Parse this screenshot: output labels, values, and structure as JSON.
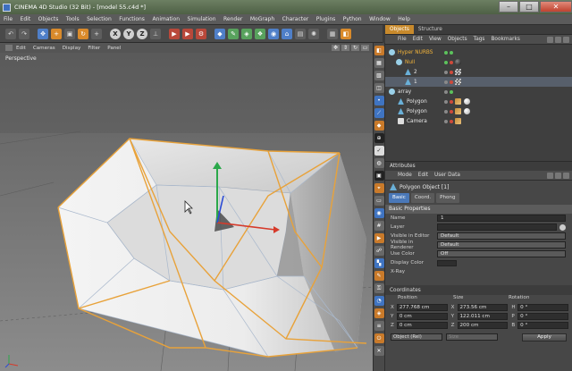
{
  "window": {
    "title": "CINEMA 4D Studio (32 Bit) - [model 55.c4d *]"
  },
  "menubar": [
    "File",
    "Edit",
    "Objects",
    "Tools",
    "Selection",
    "Functions",
    "Animation",
    "Simulation",
    "Render",
    "MoGraph",
    "Character",
    "Plugins",
    "Python",
    "Window",
    "Help"
  ],
  "toolbar": {
    "icons": [
      {
        "name": "undo-icon",
        "glyph": "↶",
        "cls": ""
      },
      {
        "name": "redo-icon",
        "glyph": "↷",
        "cls": ""
      },
      {
        "name": "live-selection-icon",
        "glyph": "✥",
        "cls": "gap blue"
      },
      {
        "name": "move-icon",
        "glyph": "+",
        "cls": "orange"
      },
      {
        "name": "scale-icon",
        "glyph": "▣",
        "cls": ""
      },
      {
        "name": "rotate-icon",
        "glyph": "↻",
        "cls": "orange"
      },
      {
        "name": "recent-tool-icon",
        "glyph": "+",
        "cls": ""
      },
      {
        "name": "x-axis-icon",
        "glyph": "X",
        "cls": "gap circle"
      },
      {
        "name": "y-axis-icon",
        "glyph": "Y",
        "cls": "circle"
      },
      {
        "name": "z-axis-icon",
        "glyph": "Z",
        "cls": "circle"
      },
      {
        "name": "coordinate-system-icon",
        "glyph": "⊥",
        "cls": ""
      },
      {
        "name": "render-view-icon",
        "glyph": "▶",
        "cls": "gap red"
      },
      {
        "name": "render-picture-viewer-icon",
        "glyph": "▶",
        "cls": "red"
      },
      {
        "name": "render-settings-icon",
        "glyph": "⚙",
        "cls": "red"
      },
      {
        "name": "cube-icon",
        "glyph": "◆",
        "cls": "gap blue"
      },
      {
        "name": "spline-pen-icon",
        "glyph": "✎",
        "cls": "green"
      },
      {
        "name": "subdivision-icon",
        "glyph": "◈",
        "cls": "green"
      },
      {
        "name": "array-icon",
        "glyph": "❖",
        "cls": "green"
      },
      {
        "name": "deformer-icon",
        "glyph": "◉",
        "cls": "blue"
      },
      {
        "name": "scene-icon",
        "glyph": "⌂",
        "cls": "blue"
      },
      {
        "name": "camera-icon",
        "glyph": "▤",
        "cls": ""
      },
      {
        "name": "light-icon",
        "glyph": "✺",
        "cls": ""
      },
      {
        "name": "model-mode-icon",
        "glyph": "▦",
        "cls": "gap"
      },
      {
        "name": "texture-mode-icon",
        "glyph": "◧",
        "cls": "orange"
      }
    ]
  },
  "viewport": {
    "menu": [
      "Edit",
      "Cameras",
      "Display",
      "Filter",
      "Panel"
    ],
    "label": "Perspective"
  },
  "right_panel": {
    "tabs": [
      "Objects",
      "Structure"
    ],
    "active_tab": "Objects",
    "menu": [
      "File",
      "Edit",
      "View",
      "Objects",
      "Tags",
      "Bookmarks"
    ],
    "tree": [
      {
        "name": "Hyper NURBS",
        "icon": "null",
        "hl": true,
        "tags": []
      },
      {
        "name": "Null",
        "icon": "null",
        "hl": true,
        "tags": [
          "dark"
        ]
      },
      {
        "name": "2",
        "icon": "tri",
        "hl": false,
        "tags": [
          "check"
        ]
      },
      {
        "name": "1",
        "icon": "tri",
        "hl": false,
        "tags": [
          "check"
        ]
      },
      {
        "name": "array",
        "icon": "null",
        "hl": false,
        "tags": []
      },
      {
        "name": "Polygon",
        "icon": "tri",
        "hl": false,
        "tags": [
          "phong",
          "ball"
        ]
      },
      {
        "name": "Polygon",
        "icon": "tri",
        "hl": false,
        "tags": [
          "phong",
          "ball"
        ]
      },
      {
        "name": "Camera",
        "icon": "cam",
        "hl": false,
        "tags": [
          "phong"
        ]
      }
    ],
    "attributes": {
      "header": "Attributes",
      "menu": [
        "Mode",
        "Edit",
        "User Data"
      ],
      "object_title": "Polygon Object [1]",
      "tabs": [
        "Basic",
        "Coord.",
        "Phong"
      ],
      "active_tab": "Basic",
      "section": "Basic Properties",
      "props": [
        {
          "label": "Name",
          "value": "1",
          "kind": "text"
        },
        {
          "label": "Layer",
          "value": "",
          "kind": "text_dot"
        },
        {
          "label": "Visible in Editor",
          "value": "Default",
          "kind": "dd"
        },
        {
          "label": "Visible in Renderer",
          "value": "Default",
          "kind": "dd"
        },
        {
          "label": "Use Color",
          "value": "Off",
          "kind": "dd"
        },
        {
          "label": "Display Color",
          "value": "",
          "kind": "swatch"
        },
        {
          "label": "X-Ray",
          "value": "",
          "kind": "plain"
        }
      ]
    },
    "coordinates": {
      "header": "Coordinates",
      "columns": [
        "Position",
        "Size",
        "Rotation"
      ],
      "rows": [
        {
          "axes": [
            "X",
            "X",
            "H"
          ],
          "values": [
            "277.768 cm",
            "273.56 cm",
            "0 °"
          ]
        },
        {
          "axes": [
            "Y",
            "Y",
            "P"
          ],
          "values": [
            "0 cm",
            "122.011 cm",
            "0 °"
          ]
        },
        {
          "axes": [
            "Z",
            "Z",
            "B"
          ],
          "values": [
            "0 cm",
            "200 cm",
            "0 °"
          ]
        }
      ],
      "footer": {
        "mode": "Object (Rel)",
        "size_mode": "Size",
        "apply": "Apply"
      }
    }
  },
  "colors": {
    "accent": "#c88a2c",
    "selection_blue": "#4a78b8",
    "edge_orange": "#e8a23a"
  }
}
